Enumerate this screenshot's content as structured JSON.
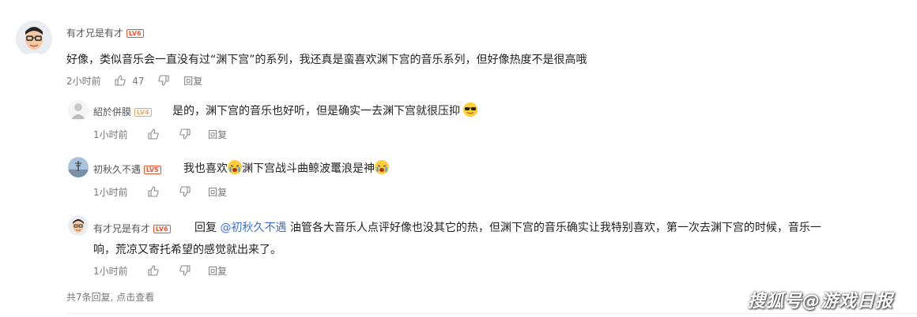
{
  "comments": [
    {
      "user": "有才兄是有才",
      "level": "LV6",
      "text": "好像，类似音乐会一直没有过“渊下宫”的系列，我还真是蛮喜欢渊下宫的音乐系列，但好像热度不是很高哦",
      "time": "2小时前",
      "likes": "47",
      "reply_label": "回复"
    },
    {
      "user": "紹於併膜",
      "level": "LV4",
      "text": "是的，渊下宫的音乐也好听，但是确实一去渊下宫就很压抑",
      "time": "1小时前",
      "reply_label": "回复"
    },
    {
      "user": "初秋久不遇",
      "level": "LV5",
      "text_a": "我也喜欢",
      "text_b": "渊下宫战斗曲鲸波鼍浪是神",
      "time": "1小时前",
      "reply_label": "回复"
    },
    {
      "user": "有才兄是有才",
      "level": "LV6",
      "reply_prefix": "回复",
      "mention": "@初秋久不遇",
      "text_line1": "油管各大音乐人点评好像也没其它的热，但渊下宫的音乐确实让我特别喜欢，第一次去渊下宫的时候，音乐一",
      "text_line2": "响，荒凉又寄托希望的感觉就出来了。",
      "time": "1小时前",
      "reply_label": "回复"
    }
  ],
  "footer": {
    "summary": "共7条回复, 点击查看"
  },
  "watermark": "搜狐号@游戏日报",
  "colors": {
    "level_badge": "#e8552f",
    "mention": "#3b6fd6",
    "meta": "#777777"
  },
  "icons": [
    "thumbs-up-icon",
    "thumbs-down-icon"
  ]
}
